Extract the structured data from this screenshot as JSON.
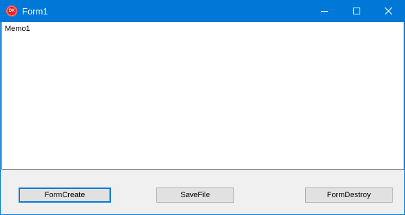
{
  "window": {
    "title": "Form1",
    "icon": "delphi-app-icon",
    "icon_text": "DX",
    "accent_color": "#0078d7"
  },
  "titlebar_buttons": {
    "minimize": "minimize-icon",
    "maximize": "maximize-icon",
    "close": "close-icon"
  },
  "memo": {
    "text": "Memo1"
  },
  "buttons": {
    "form_create": "FormCreate",
    "save_file": "SaveFile",
    "form_destroy": "FormDestroy"
  }
}
